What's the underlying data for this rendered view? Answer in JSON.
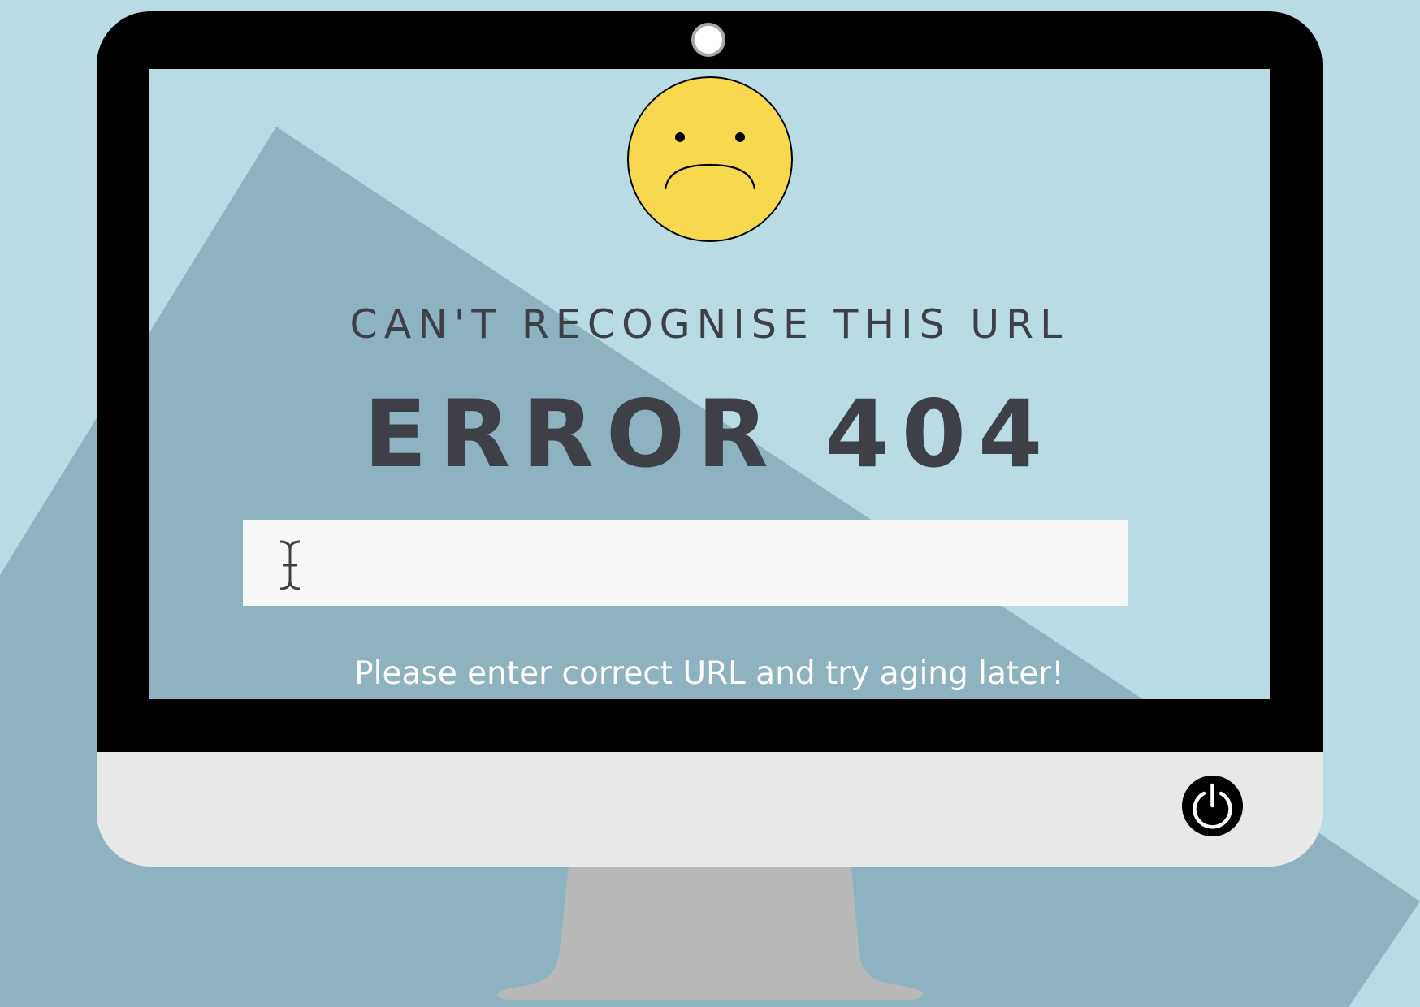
{
  "colors": {
    "background": "#b9dce4",
    "mountain": "#8db3c1",
    "bezel": "#000000",
    "chin": "#e8e8e8",
    "stand": "#b8b8b8",
    "emoji_face": "#f8d84f",
    "text_dark": "#3f4047",
    "text_light": "#ffffff",
    "input_bg": "#f7f7f7"
  },
  "icons": {
    "emoji": "sad-face-icon",
    "cursor": "text-cursor-icon",
    "power": "power-icon",
    "webcam": "webcam-icon"
  },
  "error_page": {
    "subtitle": "CAN'T RECOGNISE THIS URL",
    "headline": "ERROR 404",
    "url_input": {
      "value": "",
      "placeholder": ""
    },
    "hint": "Please enter correct URL and try aging later!"
  }
}
